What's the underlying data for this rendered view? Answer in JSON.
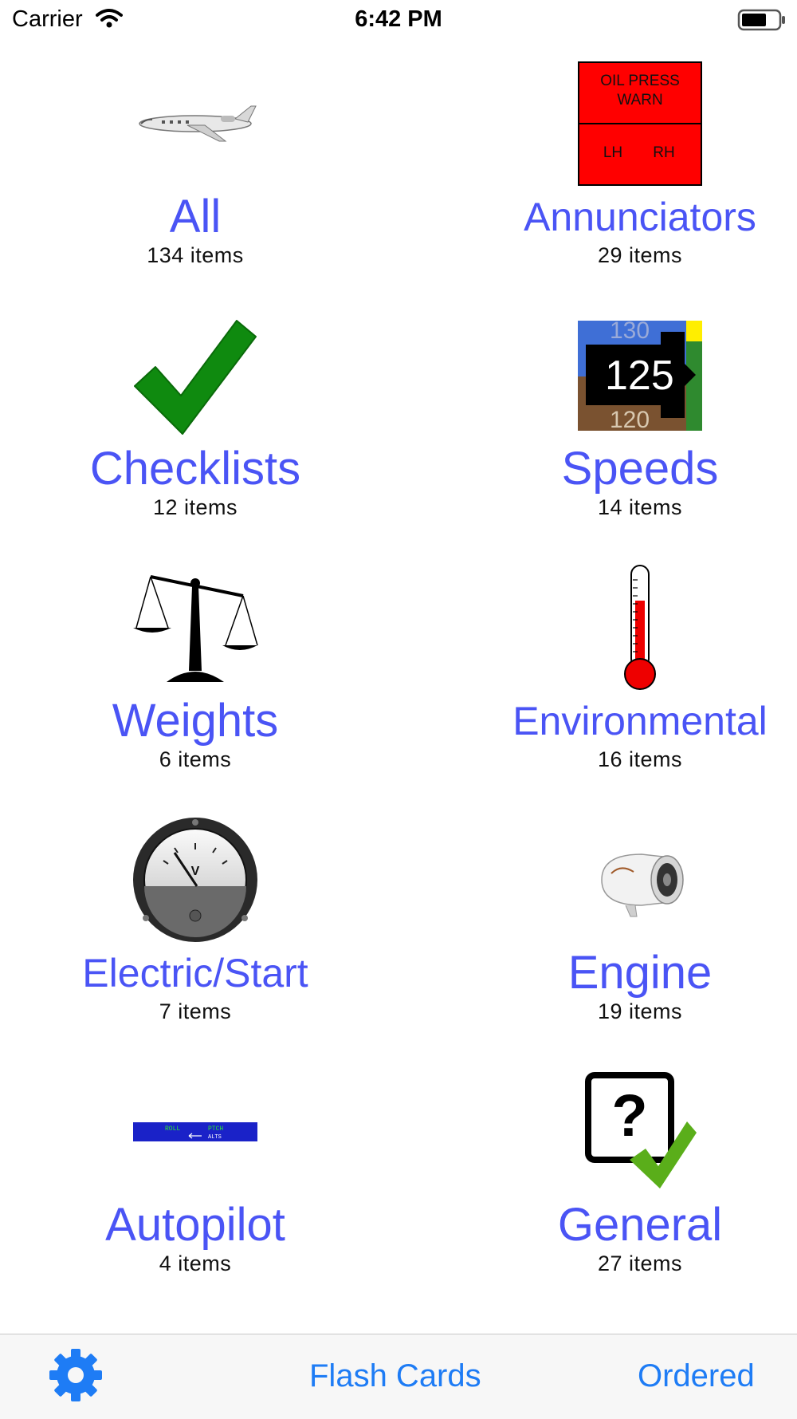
{
  "status": {
    "carrier": "Carrier",
    "time": "6:42 PM",
    "icons": [
      "wifi-icon",
      "battery-icon"
    ]
  },
  "categories": [
    {
      "label": "All",
      "count": "134 items",
      "icon": "jet-aircraft-icon"
    },
    {
      "label": "Annunciators",
      "count": "29 items",
      "icon": "annunciator-panel-icon",
      "icon_text": {
        "top": "OIL PRESS WARN",
        "left": "LH",
        "right": "RH"
      }
    },
    {
      "label": "Checklists",
      "count": "12 items",
      "icon": "checkmark-icon"
    },
    {
      "label": "Speeds",
      "count": "14 items",
      "icon": "airspeed-tape-icon",
      "icon_text": {
        "upper": "130",
        "value": "125",
        "lower": "120"
      }
    },
    {
      "label": "Weights",
      "count": "6 items",
      "icon": "balance-scale-icon"
    },
    {
      "label": "Environmental",
      "count": "16 items",
      "icon": "thermometer-icon"
    },
    {
      "label": "Electric/Start",
      "count": "7 items",
      "icon": "voltmeter-gauge-icon",
      "icon_text": {
        "unit": "V"
      }
    },
    {
      "label": "Engine",
      "count": "19 items",
      "icon": "jet-engine-icon"
    },
    {
      "label": "Autopilot",
      "count": "4 items",
      "icon": "autopilot-display-icon",
      "icon_text": {
        "roll": "ROLL",
        "pitch": "PTCH",
        "alts": "ALTS"
      }
    },
    {
      "label": "General",
      "count": "27 items",
      "icon": "question-check-icon",
      "icon_text": {
        "mark": "?"
      }
    }
  ],
  "tabbar": {
    "settings_icon": "gear-icon",
    "flash_cards": "Flash Cards",
    "ordered": "Ordered"
  },
  "colors": {
    "label": "#4a54f5",
    "tab_tint": "#1e7cf5",
    "annunciator_red": "#ff0000",
    "check_green": "#0f8a0f"
  }
}
